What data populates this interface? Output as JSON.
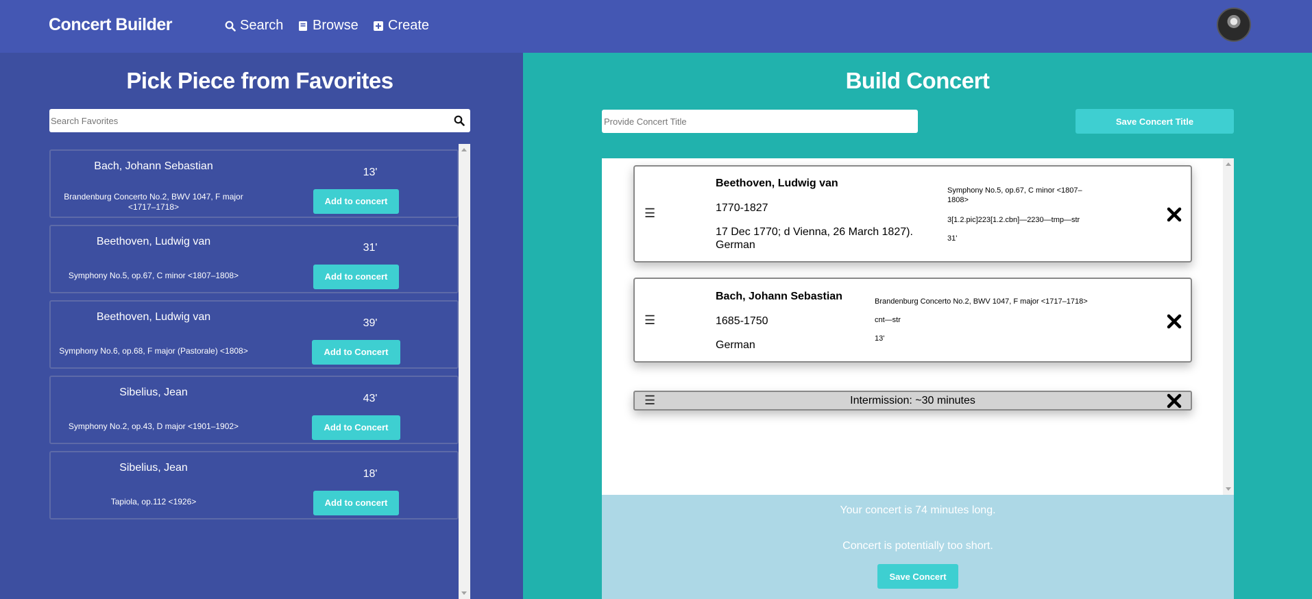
{
  "navbar": {
    "brand": "Concert Builder",
    "links": [
      {
        "label": "Search",
        "icon": "search-icon"
      },
      {
        "label": "Browse",
        "icon": "book-icon"
      },
      {
        "label": "Create",
        "icon": "plus-square-icon"
      }
    ],
    "avatar": "user-avatar"
  },
  "favorites": {
    "title": "Pick Piece from Favorites",
    "search_placeholder": "Search Favorites",
    "items": [
      {
        "composer": "Bach, Johann Sebastian",
        "work": "Brandenburg Concerto No.2, BWV 1047, F major <1717–1718>",
        "duration": "13'",
        "button": "Add to concert"
      },
      {
        "composer": "Beethoven, Ludwig van",
        "work": "Symphony No.5, op.67, C minor <1807–1808>",
        "duration": "31'",
        "button": "Add to concert"
      },
      {
        "composer": "Beethoven, Ludwig van",
        "work": "Symphony No.6, op.68, F major (Pastorale) <1808>",
        "duration": "39'",
        "button": "Add to Concert"
      },
      {
        "composer": "Sibelius, Jean",
        "work": "Symphony No.2, op.43, D major <1901–1902>",
        "duration": "43'",
        "button": "Add to Concert"
      },
      {
        "composer": "Sibelius, Jean",
        "work": "Tapiola, op.112 <1926>",
        "duration": "18'",
        "button": "Add to concert"
      }
    ]
  },
  "concert": {
    "title": "Build Concert",
    "title_placeholder": "Provide Concert Title",
    "save_title_label": "Save Concert Title",
    "items": [
      {
        "composer": "Beethoven, Ludwig van",
        "dates": "1770-1827",
        "bio": "17 Dec 1770; d Vienna, 26 March 1827). German",
        "work": "Symphony No.5, op.67, C minor <1807–1808>",
        "instrumentation": "3[1.2.pic]223[1.2.cbn]—2230—tmp—str",
        "duration": "31'"
      },
      {
        "composer": "Bach, Johann Sebastian",
        "dates": "1685-1750",
        "bio": "German",
        "work": "Brandenburg Concerto No.2, BWV 1047, F major <1717–1718>",
        "instrumentation": "cnt—str",
        "duration": "13'"
      }
    ],
    "intermission": "Intermission: ~30 minutes",
    "handle_glyph": "☰",
    "length_message": "Your concert is 74 minutes long.",
    "warning_message": "Concert is potentially too short.",
    "save_label": "Save Concert"
  }
}
